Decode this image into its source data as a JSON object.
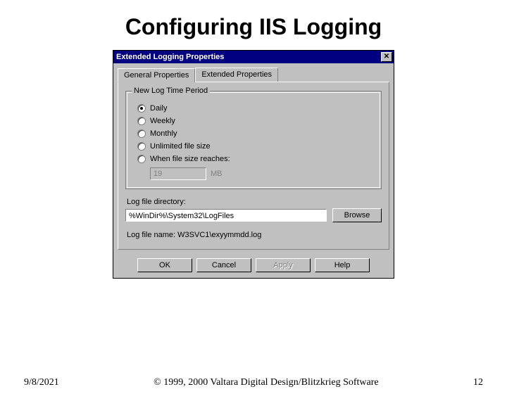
{
  "slide": {
    "title": "Configuring IIS Logging",
    "date": "9/8/2021",
    "copyright": "© 1999, 2000 Valtara Digital Design/Blitzkrieg Software",
    "page_number": "12"
  },
  "dialog": {
    "title": "Extended Logging Properties",
    "close_symbol": "✕",
    "tabs": {
      "general": "General Properties",
      "extended": "Extended Properties"
    },
    "group": {
      "legend": "New Log Time Period",
      "options": {
        "daily": "Daily",
        "weekly": "Weekly",
        "monthly": "Monthly",
        "unlimited": "Unlimited file size",
        "when_size": "When file size reaches:"
      },
      "size_value": "19",
      "size_unit": "MB"
    },
    "directory": {
      "label": "Log file directory:",
      "value": "%WinDir%\\System32\\LogFiles",
      "browse": "Browse"
    },
    "filename_label": "Log file name: W3SVC1\\exyymmdd.log",
    "buttons": {
      "ok": "OK",
      "cancel": "Cancel",
      "apply": "Apply",
      "help": "Help"
    }
  }
}
